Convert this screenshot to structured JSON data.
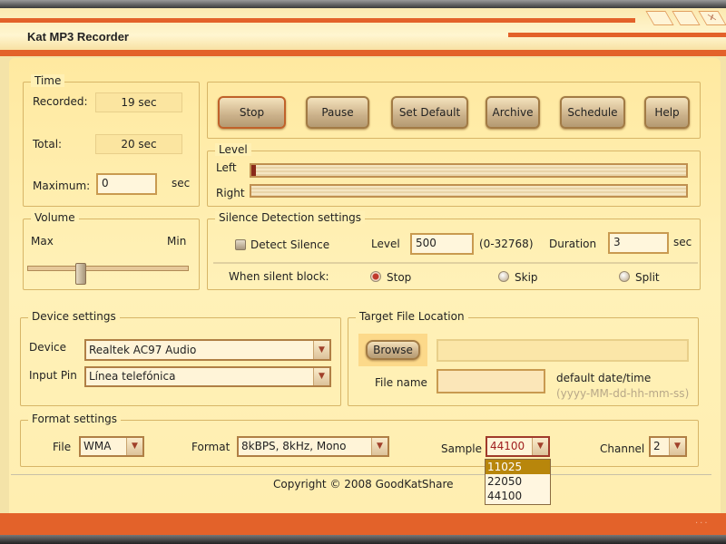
{
  "window": {
    "title": "Kat MP3 Recorder"
  },
  "time": {
    "legend": "Time",
    "recorded_label": "Recorded:",
    "recorded_value": "19 sec",
    "total_label": "Total:",
    "total_value": "20 sec",
    "maximum_label": "Maximum:",
    "maximum_value": "0",
    "maximum_unit": "sec"
  },
  "toolbar": {
    "stop": "Stop",
    "pause": "Pause",
    "set_default": "Set Default",
    "archive": "Archive",
    "schedule": "Schedule",
    "help": "Help"
  },
  "level": {
    "legend": "Level",
    "left_label": "Left",
    "right_label": "Right",
    "left_value": 0.01,
    "right_value": 0
  },
  "volume": {
    "legend": "Volume",
    "max_label": "Max",
    "min_label": "Min",
    "value": 0.7
  },
  "silence": {
    "legend": "Silence Detection settings",
    "detect_label": "Detect Silence",
    "detect_checked": false,
    "level_label": "Level",
    "level_value": "500",
    "level_range": "(0-32768)",
    "duration_label": "Duration",
    "duration_value": "3",
    "duration_unit": "sec",
    "block_label": "When silent block:",
    "options": [
      "Stop",
      "Skip",
      "Split"
    ],
    "selected": "Stop"
  },
  "device": {
    "legend": "Device settings",
    "device_label": "Device",
    "device_value": "Realtek AC97 Audio",
    "pin_label": "Input Pin",
    "pin_value": "Línea telefónica"
  },
  "target": {
    "legend": "Target File Location",
    "browse": "Browse",
    "path_value": "",
    "filename_label": "File name",
    "filename_value": "",
    "default_label": "default date/time",
    "default_format": "(yyyy-MM-dd-hh-mm-ss)"
  },
  "format": {
    "legend": "Format settings",
    "file_label": "File",
    "file_value": "WMA",
    "format_label": "Format",
    "format_value": "8kBPS, 8kHz, Mono",
    "sample_label": "Sample",
    "sample_value": "44100",
    "sample_options": [
      "11025",
      "22050",
      "44100"
    ],
    "sample_highlighted": "11025",
    "channel_label": "Channel",
    "channel_value": "2"
  },
  "footer": {
    "copyright": "Copyright © 2008 GoodKatShare"
  },
  "colors": {
    "accent": "#e3622a",
    "panel": "#fff0b4",
    "highlight": "#b8860b"
  }
}
